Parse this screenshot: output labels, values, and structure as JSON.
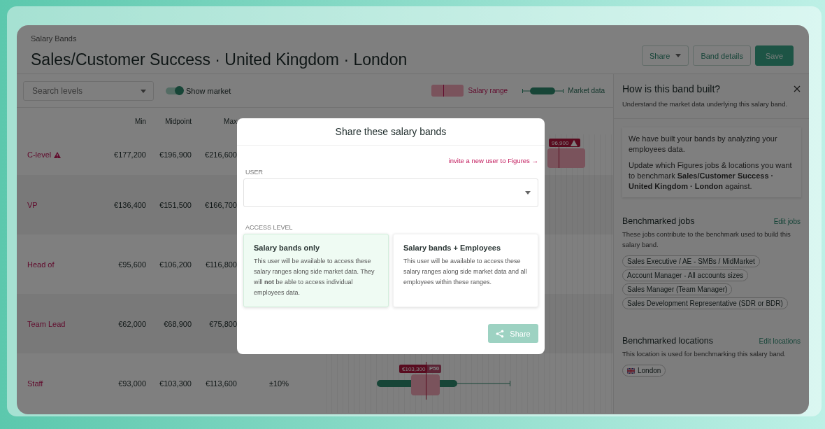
{
  "header": {
    "breadcrumb": "Salary Bands",
    "title": "Sales/Customer Success · United Kingdom · London",
    "buttons": [
      {
        "kind": "dropdown",
        "label": "Share"
      },
      {
        "kind": "outline",
        "label": "Band details"
      },
      {
        "kind": "primary",
        "label": "Save"
      }
    ]
  },
  "toolbar": {
    "search": {
      "placeholder": "Search levels"
    },
    "show_market": {
      "label": "Show market",
      "on": true
    },
    "legend": [
      {
        "kind": "salary",
        "label": "Salary range"
      },
      {
        "kind": "market",
        "label": "Market data"
      }
    ]
  },
  "table": {
    "columns": [
      "Min",
      "Midpoint",
      "Max"
    ],
    "rows": [
      {
        "level": "C-level",
        "warning": true,
        "min": "€177,200",
        "mid": "€196,900",
        "max": "€216,600",
        "band": {
          "tag": "96,900",
          "warning": true
        }
      },
      {
        "level": "VP",
        "warning": false,
        "min": "€136,400",
        "mid": "€151,500",
        "max": "€166,700"
      },
      {
        "level": "Head of",
        "warning": false,
        "min": "€95,600",
        "mid": "€106,200",
        "max": "€116,800"
      },
      {
        "level": "Team Lead",
        "warning": false,
        "min": "€62,000",
        "mid": "€68,900",
        "max": "€75,800"
      },
      {
        "level": "Staff",
        "warning": false,
        "min": "€93,000",
        "mid": "€103,300",
        "max": "€113,600",
        "spread": "±10%",
        "band": {
          "tag": "€103,300",
          "percentile": "P50",
          "market": true
        }
      }
    ]
  },
  "panel": {
    "title": "How is this band built?",
    "subtitle": "Understand the market data underlying this salary band.",
    "info": [
      "We have built your bands by analyzing your employees data.",
      "Update which Figures jobs & locations you want to benchmark **Sales/Customer Success · United Kingdom · London** against."
    ],
    "sections": [
      {
        "title": "Benchmarked jobs",
        "action": "Edit jobs",
        "description": "These jobs contribute to the benchmark used to build this salary band.",
        "chips": [
          {
            "label": "Sales Executive / AE - SMBs / MidMarket",
            "flag": false
          },
          {
            "label": "Account Manager - All accounts sizes",
            "flag": false
          },
          {
            "label": "Sales Manager (Team Manager)",
            "flag": false
          },
          {
            "label": "Sales Development Representative (SDR or BDR)",
            "flag": false
          }
        ]
      },
      {
        "title": "Benchmarked locations",
        "action": "Edit locations",
        "description": "This location is used for benchmarking this salary band.",
        "chips": [
          {
            "label": "London",
            "flag": true
          }
        ]
      }
    ]
  },
  "modal": {
    "title": "Share these salary bands",
    "invite_link": "invite a new user to Figures →",
    "user_label": "USER",
    "access_label": "ACCESS LEVEL",
    "options": [
      {
        "title": "Salary bands only",
        "description": "This user will be available to access these salary ranges along side market data. They will **not** be able to access individual employees data.",
        "selected": true
      },
      {
        "title": "Salary bands + Employees",
        "description": "This user will be available to access these salary ranges along side market data and all employees within these ranges.",
        "selected": false
      }
    ],
    "share_button": {
      "label": "Share",
      "disabled": true
    }
  }
}
